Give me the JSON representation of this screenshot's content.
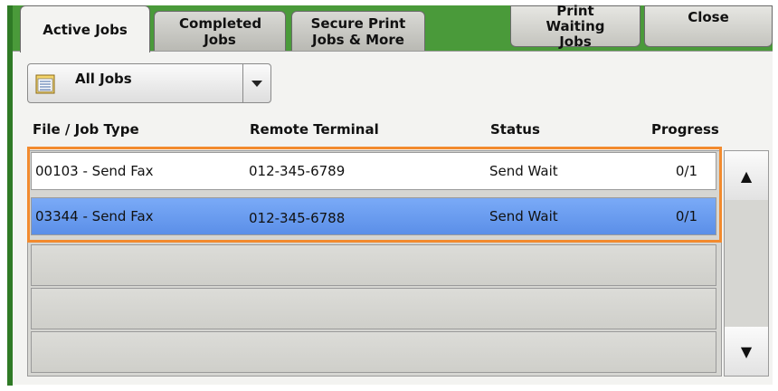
{
  "tabs": [
    {
      "label": "Active Jobs"
    },
    {
      "label": "Completed Jobs"
    },
    {
      "label": "Secure Print Jobs & More"
    }
  ],
  "top_buttons": {
    "print_waiting": "Print Waiting Jobs",
    "close": "Close"
  },
  "filter": {
    "selected": "All Jobs"
  },
  "columns": {
    "file": "File / Job Type",
    "remote": "Remote Terminal",
    "status": "Status",
    "progress": "Progress"
  },
  "jobs": [
    {
      "file": "00103 - Send Fax",
      "remote": "012-345-6789",
      "status": "Send Wait",
      "progress": "0/1"
    },
    {
      "file": "03344 - Send Fax",
      "remote": "012-345-6788",
      "status": "Send Wait",
      "progress": "0/1"
    }
  ],
  "scroll": {
    "up": "▲",
    "down": "▼"
  },
  "colors": {
    "frame_green": "#4a9a3a",
    "selected_row": "#6a9cf0",
    "highlight": "#f28a2e"
  }
}
